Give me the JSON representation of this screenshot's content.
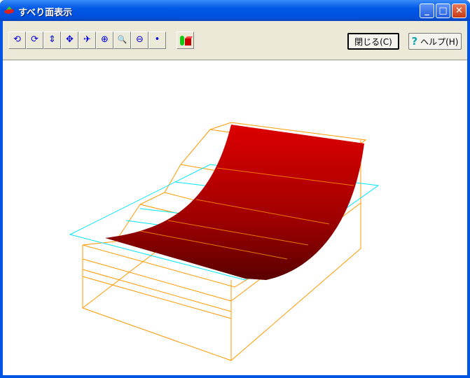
{
  "window": {
    "title": "すべり面表示",
    "app_icon": "slope-app-icon"
  },
  "title_buttons": {
    "minimize": "_",
    "maximize": "□",
    "close": "✕"
  },
  "toolbar": {
    "tools": [
      {
        "name": "rotate-horizontal-icon",
        "glyph": "⟲"
      },
      {
        "name": "rotate-vertical-icon",
        "glyph": "⟳"
      },
      {
        "name": "move-vertical-icon",
        "glyph": "⇕"
      },
      {
        "name": "move-all-icon",
        "glyph": "✥"
      },
      {
        "name": "plane-view-icon",
        "glyph": "✈"
      },
      {
        "name": "zoom-fit-icon",
        "glyph": "⊕"
      },
      {
        "name": "zoom-in-icon",
        "glyph": "🔍"
      },
      {
        "name": "zoom-out-icon",
        "glyph": "⊖"
      },
      {
        "name": "dot-icon",
        "glyph": "•"
      }
    ],
    "close_label": "閉じる(C)",
    "help_label": "ヘルプ(H)",
    "help_glyph": "?"
  },
  "colors": {
    "surface": "#CC0000",
    "wireframe": "#FF9900",
    "plane": "#00E5FF"
  }
}
